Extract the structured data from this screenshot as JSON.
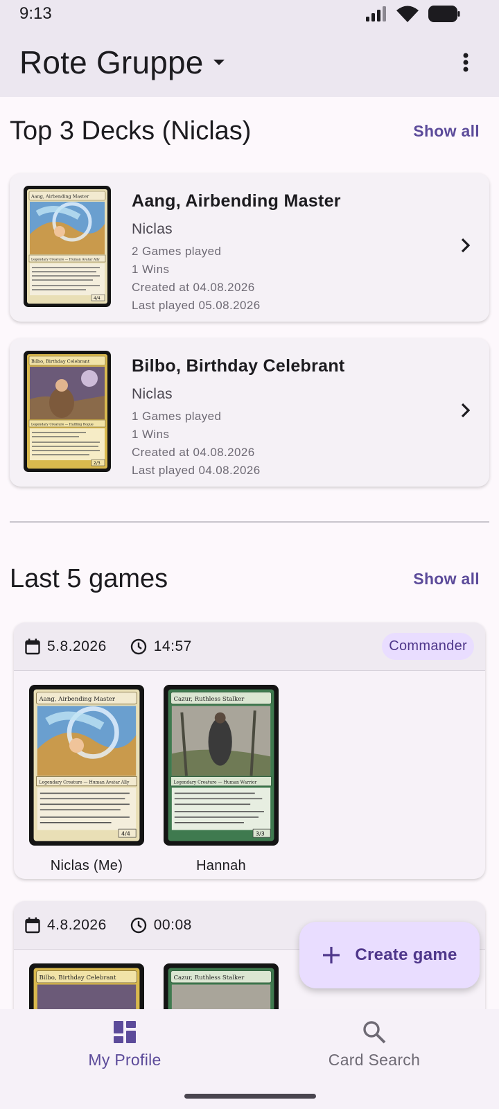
{
  "status_bar": {
    "time": "9:13"
  },
  "app_bar": {
    "title": "Rote Gruppe"
  },
  "top_decks": {
    "title": "Top 3 Decks (Niclas)",
    "show_all": "Show all",
    "decks": [
      {
        "name": "Aang, Airbending Master",
        "owner": "Niclas",
        "games": "2 Games played",
        "wins": "1 Wins",
        "created": "Created at 04.08.2026",
        "last_played": "Last played 05.08.2026",
        "card_title": "Aang, Airbending Master",
        "card_type": "Legendary Creature — Human Avatar Ally",
        "card_pt": "4/4"
      },
      {
        "name": "Bilbo, Birthday Celebrant",
        "owner": "Niclas",
        "games": "1 Games played",
        "wins": "1 Wins",
        "created": "Created at 04.08.2026",
        "last_played": "Last played 04.08.2026",
        "card_title": "Bilbo, Birthday Celebrant",
        "card_type": "Legendary Creature — Halfling Rogue",
        "card_pt": "2/3"
      }
    ]
  },
  "last_games": {
    "title": "Last 5 games",
    "show_all": "Show all",
    "games": [
      {
        "date": "5.8.2026",
        "time": "14:57",
        "mode": "Commander",
        "players": [
          {
            "name": "Niclas (Me)",
            "card_title": "Aang, Airbending Master",
            "card_type": "Legendary Creature — Human Avatar Ally",
            "card_pt": "4/4"
          },
          {
            "name": "Hannah",
            "card_title": "Cazur, Ruthless Stalker",
            "card_type": "Legendary Creature — Human Warrior",
            "card_pt": "3/3"
          }
        ]
      },
      {
        "date": "4.8.2026",
        "time": "00:08",
        "players": [
          {
            "card_title": "Bilbo, Birthday Celebrant"
          },
          {
            "card_title": "Cazur, Ruthless Stalker"
          }
        ]
      }
    ]
  },
  "fab": {
    "label": "Create game"
  },
  "bottom_nav": {
    "items": [
      {
        "label": "My Profile"
      },
      {
        "label": "Card Search"
      }
    ]
  }
}
